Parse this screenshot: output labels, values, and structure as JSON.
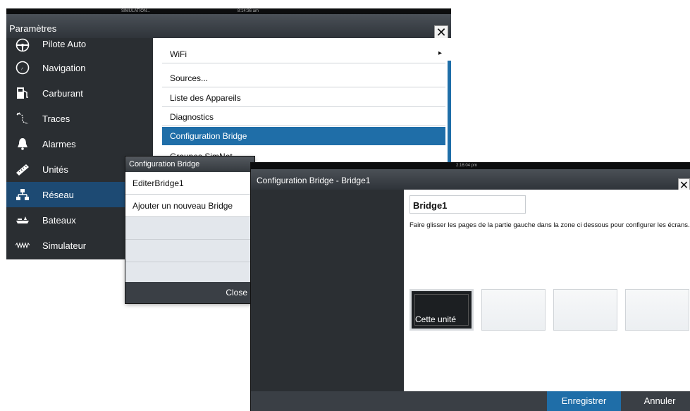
{
  "settings": {
    "status_left": "SIMULATION...",
    "status_time": "8:14:36 am",
    "title": "Paramètres",
    "sidebar": [
      {
        "label": "Pilote Auto",
        "icon": "steering-wheel-icon"
      },
      {
        "label": "Navigation",
        "icon": "compass-icon"
      },
      {
        "label": "Carburant",
        "icon": "fuel-pump-icon"
      },
      {
        "label": "Traces",
        "icon": "tracks-icon"
      },
      {
        "label": "Alarmes",
        "icon": "bell-icon"
      },
      {
        "label": "Unités",
        "icon": "ruler-icon"
      },
      {
        "label": "Réseau",
        "icon": "network-icon",
        "active": true
      },
      {
        "label": "Bateaux",
        "icon": "ships-icon"
      },
      {
        "label": "Simulateur",
        "icon": "wave-icon"
      }
    ],
    "menu": [
      {
        "label": "WiFi",
        "arrow": "▸"
      },
      {
        "label": "Sources..."
      },
      {
        "label": "Liste des Appareils"
      },
      {
        "label": "Diagnostics"
      },
      {
        "label": "Configuration Bridge",
        "selected": true
      },
      {
        "label": "Groupes SimNet..."
      }
    ]
  },
  "bridge_list": {
    "title": "Configuration Bridge",
    "items": [
      "EditerBridge1",
      "Ajouter un nouveau Bridge"
    ],
    "close_label": "Close"
  },
  "bridge_edit": {
    "status_time": "2:16:04 pm",
    "title": "Configuration Bridge - Bridge1",
    "name_value": "Bridge1",
    "instruction": "Faire glisser les pages de la partie gauche dans la zone ci dessous pour configurer les écrans.",
    "unit_label": "Cette unité",
    "save_label": "Enregistrer",
    "cancel_label": "Annuler"
  },
  "colors": {
    "accent": "#1f6ea8",
    "sidebar_bg": "#2a2e32",
    "sidebar_active": "#1d4a73"
  }
}
